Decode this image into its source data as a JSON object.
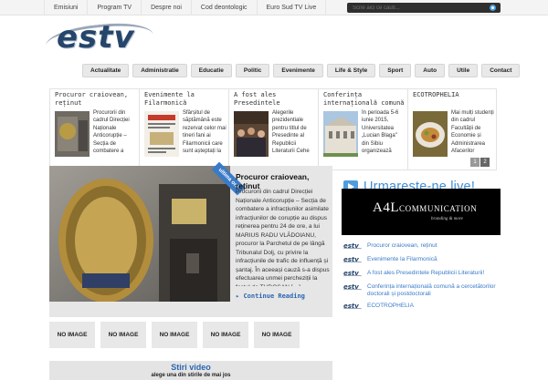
{
  "topnav": {
    "items": [
      "Emisiuni",
      "Program TV",
      "Despre noi",
      "Cod deontologic",
      "Euro Sud TV Live"
    ],
    "search_placeholder": "Scrie aici ce cauti..."
  },
  "logo": {
    "text": "estv"
  },
  "menu": [
    "Actualitate",
    "Administratie",
    "Educatie",
    "Politic",
    "Evenimente",
    "Life & Style",
    "Sport",
    "Auto",
    "Utile",
    "Contact"
  ],
  "carousel": {
    "items": [
      {
        "title": "Procuror craiovean, reținut",
        "text": "Procurorii din cadrul Direcției Naționale Anticorupție – Secția de combatere a"
      },
      {
        "title": "Evenimente la Filarmonică",
        "text": "Sfârșitul de săptămână este rezervat celor mai tineri fani ai Filarmonicii care sunt așteptați la"
      },
      {
        "title": "A fost ales Presedintele",
        "text": "Alegerile prezidentiale pentru titlul de Presedinte al Republicii Literaturii Cehe"
      },
      {
        "title": "Conferința internațională comună",
        "text": "În perioada 5-6 iunie 2015, Universitatea „Lucian Blaga\" din Sibiu organizează"
      },
      {
        "title": "ECOTROPHELIA",
        "text": "Mai mulți studenți din cadrul Facultății de Economie și Administrarea Afacerilor"
      }
    ],
    "pages": [
      "1",
      "2"
    ]
  },
  "featured": {
    "ribbon": "ultima oră",
    "title": "Procuror craiovean, reținut",
    "text": "Procurorii din cadrul Direcției Naționale Anticorupție – Secția de combatere a infracțiunilor asimilate infracțiunilor de corupție au dispus reținerea pentru 24 de ore, a lui MARIUS RADU VLĂDOIANU, procuror la Parchetul de pe lângă Tribunalul Dolj, cu privire la infracțiunile de trafic de influență și șantaj. În aceeași cauză s-a dispus efectuarea unmei percheziții la fostul de TUDOSAN […]",
    "more": "Continue Reading"
  },
  "no_image": [
    "NO IMAGE",
    "NO IMAGE",
    "NO IMAGE",
    "NO IMAGE",
    "NO IMAGE"
  ],
  "video": {
    "title": "Stiri video",
    "subtitle": "alege una din stirile de mai jos"
  },
  "live": {
    "title": "Urmareste-ne live!"
  },
  "ad": {
    "big": "A4L",
    "small": "COMMUNICATION",
    "tagline": "branding & more"
  },
  "sidebar_list": {
    "logo": "estv",
    "items": [
      "Procuror craiovean, reținut",
      "Evenimente la Filarmonică",
      "A fost ales Presedintele Republicii Literaturii!",
      "Conferința internațională comună a cercetătorilor doctorali și postdoctorali",
      "ECOTROPHELIA"
    ]
  }
}
